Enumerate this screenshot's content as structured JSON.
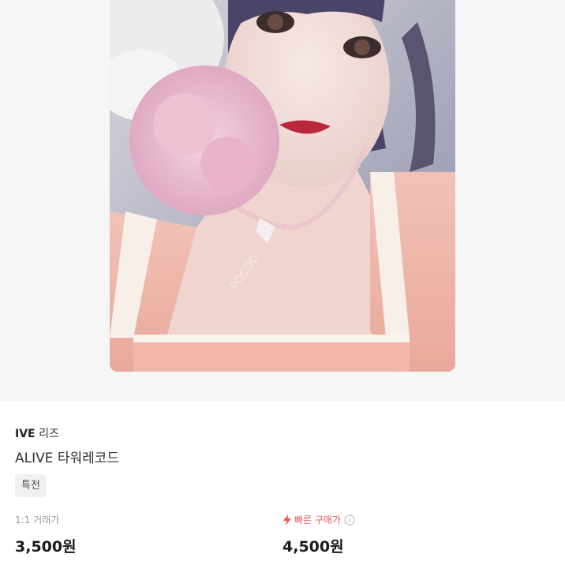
{
  "product": {
    "artist_group": "IVE",
    "artist_member": "리즈",
    "title": "ALIVE 타워레코드",
    "tag": "특전",
    "image_watermark": "POCOC"
  },
  "prices": {
    "trade_label": "1:1 거래가",
    "trade_price": "3,500원",
    "fast_label": "빠른 구매가",
    "fast_price": "4,500원"
  },
  "icons": {
    "fast_buy": "lightning-bolt-icon",
    "info": "info-circle-icon"
  },
  "colors": {
    "accent_red": "#f05454",
    "hero_bg": "#f6f6f6",
    "tag_bg": "#f0f0f0"
  }
}
